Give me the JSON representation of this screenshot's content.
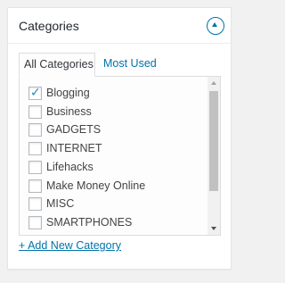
{
  "box": {
    "title": "Categories",
    "toggle_icon": "chevron-up-icon"
  },
  "tabs": [
    {
      "label": "All Categories",
      "active": true
    },
    {
      "label": "Most Used",
      "active": false
    }
  ],
  "categories": [
    {
      "label": "Blogging",
      "checked": true
    },
    {
      "label": "Business",
      "checked": false
    },
    {
      "label": "GADGETS",
      "checked": false
    },
    {
      "label": "INTERNET",
      "checked": false
    },
    {
      "label": "Lifehacks",
      "checked": false
    },
    {
      "label": "Make Money Online",
      "checked": false
    },
    {
      "label": "MISC",
      "checked": false
    },
    {
      "label": "SMARTPHONES",
      "checked": false
    }
  ],
  "add_link": "+ Add New Category",
  "colors": {
    "accent": "#0073aa",
    "check": "#1e8cbe",
    "text": "#444444",
    "title": "#23282d"
  }
}
